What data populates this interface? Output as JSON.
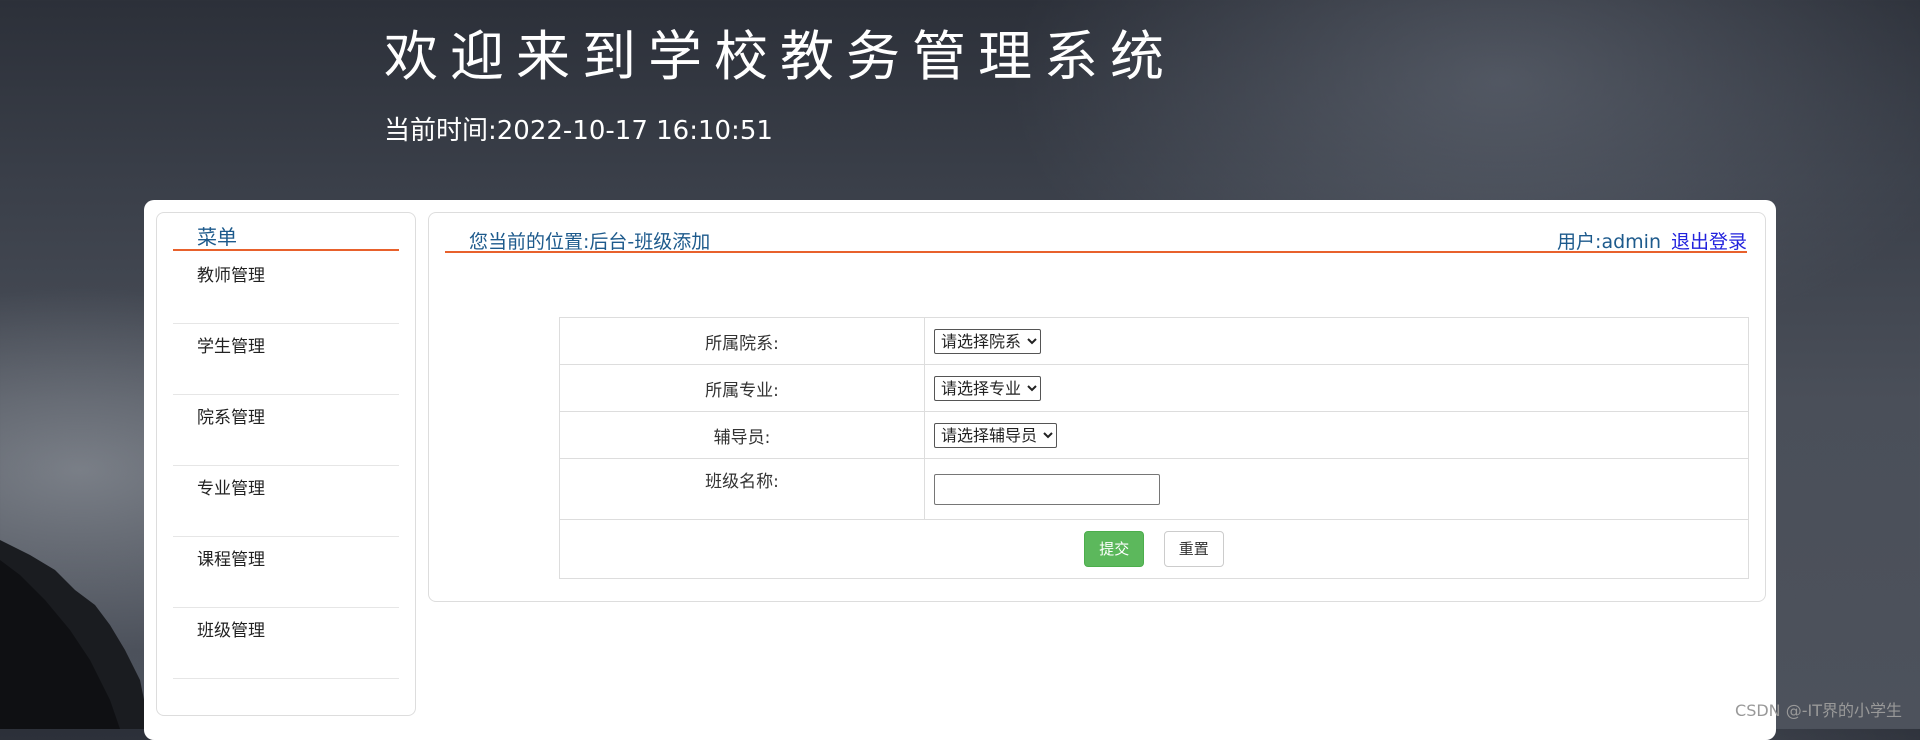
{
  "header": {
    "title": "欢迎来到学校教务管理系统",
    "clock_label": "当前时间:",
    "clock_value": "2022-10-17 16:10:51"
  },
  "sidebar": {
    "title": "菜单",
    "items": [
      {
        "label": "教师管理"
      },
      {
        "label": "学生管理"
      },
      {
        "label": "院系管理"
      },
      {
        "label": "专业管理"
      },
      {
        "label": "课程管理"
      },
      {
        "label": "班级管理"
      }
    ]
  },
  "main": {
    "breadcrumb": "您当前的位置:后台-班级添加",
    "user_label": "用户:admin",
    "logout_label": "退出登录"
  },
  "form": {
    "department": {
      "label": "所属院系:",
      "selected": "请选择院系"
    },
    "major": {
      "label": "所属专业:",
      "selected": "请选择专业"
    },
    "counselor": {
      "label": "辅导员:",
      "selected": "请选择辅导员"
    },
    "class_name": {
      "label": "班级名称:",
      "value": ""
    },
    "submit_label": "提交",
    "reset_label": "重置"
  },
  "watermark": "CSDN @-IT界的小学生"
}
